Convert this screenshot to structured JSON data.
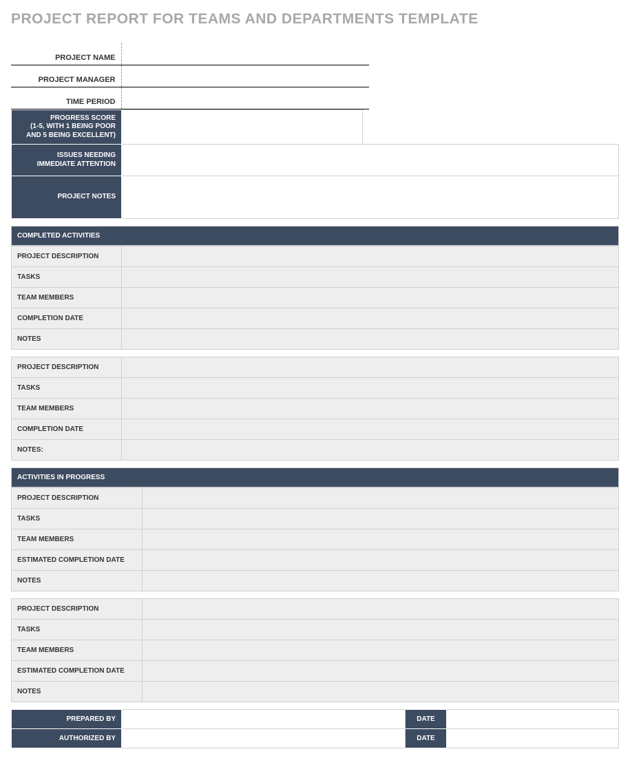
{
  "title": "PROJECT REPORT FOR TEAMS AND DEPARTMENTS TEMPLATE",
  "info": {
    "project_name_label": "PROJECT NAME",
    "project_name_value": "",
    "project_manager_label": "PROJECT MANAGER",
    "project_manager_value": "",
    "time_period_label": "TIME PERIOD",
    "time_period_value": ""
  },
  "summary": {
    "progress_score_label": "PROGRESS SCORE\n(1-5, WITH 1 BEING POOR AND 5 BEING EXCELLENT)",
    "progress_score_value": "",
    "issues_label": "ISSUES NEEDING IMMEDIATE ATTENTION",
    "issues_value": "",
    "project_notes_label": "PROJECT NOTES",
    "project_notes_value": ""
  },
  "completed": {
    "header": "COMPLETED ACTIVITIES",
    "blocks": [
      {
        "project_description_label": "PROJECT DESCRIPTION",
        "project_description_value": "",
        "tasks_label": "TASKS",
        "tasks_value": "",
        "team_members_label": "TEAM MEMBERS",
        "team_members_value": "",
        "completion_date_label": "COMPLETION DATE",
        "completion_date_value": "",
        "notes_label": "NOTES",
        "notes_value": ""
      },
      {
        "project_description_label": "PROJECT DESCRIPTION",
        "project_description_value": "",
        "tasks_label": "TASKS",
        "tasks_value": "",
        "team_members_label": "TEAM MEMBERS",
        "team_members_value": "",
        "completion_date_label": "COMPLETION DATE",
        "completion_date_value": "",
        "notes_label": "NOTES:",
        "notes_value": ""
      }
    ]
  },
  "in_progress": {
    "header": "ACTIVITIES IN PROGRESS",
    "blocks": [
      {
        "project_description_label": "PROJECT DESCRIPTION",
        "project_description_value": "",
        "tasks_label": "TASKS",
        "tasks_value": "",
        "team_members_label": "TEAM MEMBERS",
        "team_members_value": "",
        "estimated_completion_label": "ESTIMATED COMPLETION DATE",
        "estimated_completion_value": "",
        "notes_label": "NOTES",
        "notes_value": ""
      },
      {
        "project_description_label": "PROJECT DESCRIPTION",
        "project_description_value": "",
        "tasks_label": "TASKS",
        "tasks_value": "",
        "team_members_label": "TEAM MEMBERS",
        "team_members_value": "",
        "estimated_completion_label": "ESTIMATED COMPLETION DATE",
        "estimated_completion_value": "",
        "notes_label": "NOTES",
        "notes_value": ""
      }
    ]
  },
  "signature": {
    "prepared_by_label": "PREPARED BY",
    "prepared_by_value": "",
    "prepared_date_label": "DATE",
    "prepared_date_value": "",
    "authorized_by_label": "AUTHORIZED BY",
    "authorized_by_value": "",
    "authorized_date_label": "DATE",
    "authorized_date_value": ""
  }
}
